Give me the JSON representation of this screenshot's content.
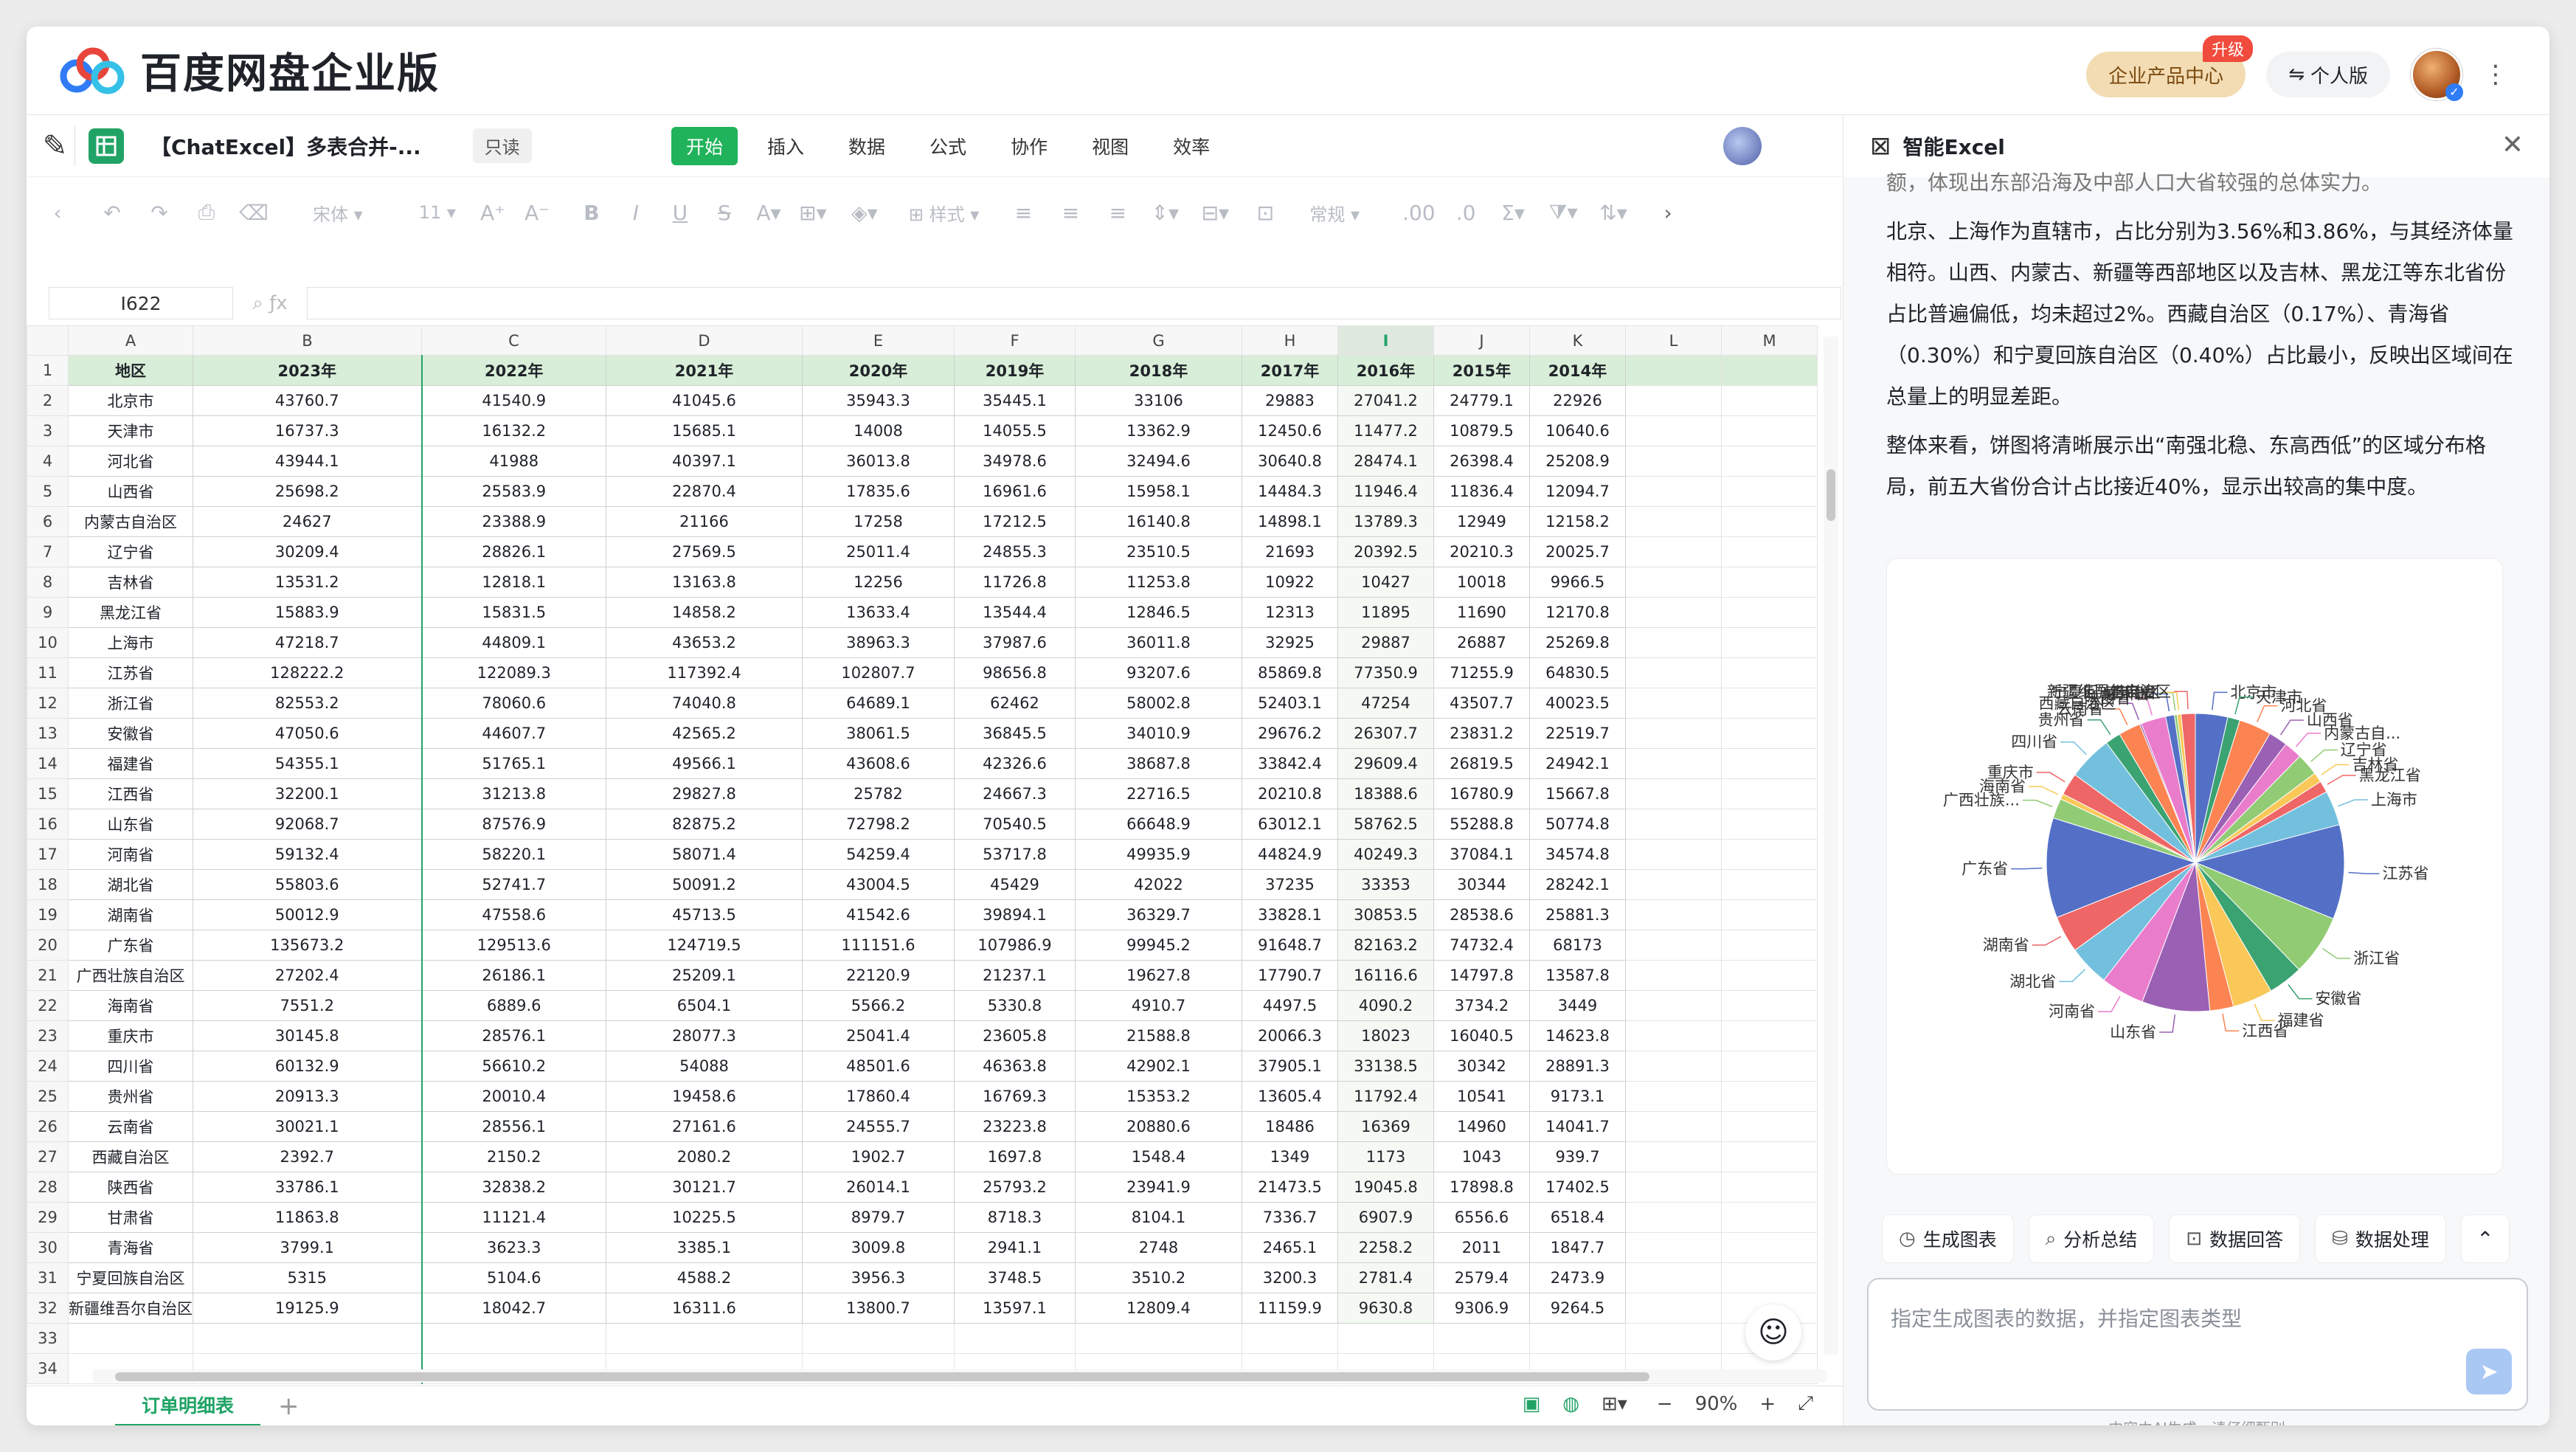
{
  "app": {
    "brand": "百度网盘企业版",
    "enterprise_center": "企业产品中心",
    "upgrade_badge": "升级",
    "personal": "个人版"
  },
  "doc": {
    "title": "【ChatExcel】多表合并-...",
    "readonly": "只读",
    "menu": [
      "开始",
      "插入",
      "数据",
      "公式",
      "协作",
      "视图",
      "效率"
    ],
    "toolbar": {
      "font": "宋体",
      "size": "11",
      "style": "样式",
      "format": "常规"
    },
    "cell_ref": "I622",
    "sheet_tab": "订单明细表",
    "zoom": "90%"
  },
  "grid": {
    "col_letters": [
      "A",
      "B",
      "C",
      "D",
      "E",
      "F",
      "G",
      "H",
      "I",
      "J",
      "K",
      "L",
      "M"
    ],
    "headers": [
      "地区",
      "2023年",
      "2022年",
      "2021年",
      "2020年",
      "2019年",
      "2018年",
      "2017年",
      "2016年",
      "2015年",
      "2014年"
    ],
    "rows": [
      [
        "北京市",
        "43760.7",
        "41540.9",
        "41045.6",
        "35943.3",
        "35445.1",
        "33106",
        "29883",
        "27041.2",
        "24779.1",
        "22926"
      ],
      [
        "天津市",
        "16737.3",
        "16132.2",
        "15685.1",
        "14008",
        "14055.5",
        "13362.9",
        "12450.6",
        "11477.2",
        "10879.5",
        "10640.6"
      ],
      [
        "河北省",
        "43944.1",
        "41988",
        "40397.1",
        "36013.8",
        "34978.6",
        "32494.6",
        "30640.8",
        "28474.1",
        "26398.4",
        "25208.9"
      ],
      [
        "山西省",
        "25698.2",
        "25583.9",
        "22870.4",
        "17835.6",
        "16961.6",
        "15958.1",
        "14484.3",
        "11946.4",
        "11836.4",
        "12094.7"
      ],
      [
        "内蒙古自治区",
        "24627",
        "23388.9",
        "21166",
        "17258",
        "17212.5",
        "16140.8",
        "14898.1",
        "13789.3",
        "12949",
        "12158.2"
      ],
      [
        "辽宁省",
        "30209.4",
        "28826.1",
        "27569.5",
        "25011.4",
        "24855.3",
        "23510.5",
        "21693",
        "20392.5",
        "20210.3",
        "20025.7"
      ],
      [
        "吉林省",
        "13531.2",
        "12818.1",
        "13163.8",
        "12256",
        "11726.8",
        "11253.8",
        "10922",
        "10427",
        "10018",
        "9966.5"
      ],
      [
        "黑龙江省",
        "15883.9",
        "15831.5",
        "14858.2",
        "13633.4",
        "13544.4",
        "12846.5",
        "12313",
        "11895",
        "11690",
        "12170.8"
      ],
      [
        "上海市",
        "47218.7",
        "44809.1",
        "43653.2",
        "38963.3",
        "37987.6",
        "36011.8",
        "32925",
        "29887",
        "26887",
        "25269.8"
      ],
      [
        "江苏省",
        "128222.2",
        "122089.3",
        "117392.4",
        "102807.7",
        "98656.8",
        "93207.6",
        "85869.8",
        "77350.9",
        "71255.9",
        "64830.5"
      ],
      [
        "浙江省",
        "82553.2",
        "78060.6",
        "74040.8",
        "64689.1",
        "62462",
        "58002.8",
        "52403.1",
        "47254",
        "43507.7",
        "40023.5"
      ],
      [
        "安徽省",
        "47050.6",
        "44607.7",
        "42565.2",
        "38061.5",
        "36845.5",
        "34010.9",
        "29676.2",
        "26307.7",
        "23831.2",
        "22519.7"
      ],
      [
        "福建省",
        "54355.1",
        "51765.1",
        "49566.1",
        "43608.6",
        "42326.6",
        "38687.8",
        "33842.4",
        "29609.4",
        "26819.5",
        "24942.1"
      ],
      [
        "江西省",
        "32200.1",
        "31213.8",
        "29827.8",
        "25782",
        "24667.3",
        "22716.5",
        "20210.8",
        "18388.6",
        "16780.9",
        "15667.8"
      ],
      [
        "山东省",
        "92068.7",
        "87576.9",
        "82875.2",
        "72798.2",
        "70540.5",
        "66648.9",
        "63012.1",
        "58762.5",
        "55288.8",
        "50774.8"
      ],
      [
        "河南省",
        "59132.4",
        "58220.1",
        "58071.4",
        "54259.4",
        "53717.8",
        "49935.9",
        "44824.9",
        "40249.3",
        "37084.1",
        "34574.8"
      ],
      [
        "湖北省",
        "55803.6",
        "52741.7",
        "50091.2",
        "43004.5",
        "45429",
        "42022",
        "37235",
        "33353",
        "30344",
        "28242.1"
      ],
      [
        "湖南省",
        "50012.9",
        "47558.6",
        "45713.5",
        "41542.6",
        "39894.1",
        "36329.7",
        "33828.1",
        "30853.5",
        "28538.6",
        "25881.3"
      ],
      [
        "广东省",
        "135673.2",
        "129513.6",
        "124719.5",
        "111151.6",
        "107986.9",
        "99945.2",
        "91648.7",
        "82163.2",
        "74732.4",
        "68173"
      ],
      [
        "广西壮族自治区",
        "27202.4",
        "26186.1",
        "25209.1",
        "22120.9",
        "21237.1",
        "19627.8",
        "17790.7",
        "16116.6",
        "14797.8",
        "13587.8"
      ],
      [
        "海南省",
        "7551.2",
        "6889.6",
        "6504.1",
        "5566.2",
        "5330.8",
        "4910.7",
        "4497.5",
        "4090.2",
        "3734.2",
        "3449"
      ],
      [
        "重庆市",
        "30145.8",
        "28576.1",
        "28077.3",
        "25041.4",
        "23605.8",
        "21588.8",
        "20066.3",
        "18023",
        "16040.5",
        "14623.8"
      ],
      [
        "四川省",
        "60132.9",
        "56610.2",
        "54088",
        "48501.6",
        "46363.8",
        "42902.1",
        "37905.1",
        "33138.5",
        "30342",
        "28891.3"
      ],
      [
        "贵州省",
        "20913.3",
        "20010.4",
        "19458.6",
        "17860.4",
        "16769.3",
        "15353.2",
        "13605.4",
        "11792.4",
        "10541",
        "9173.1"
      ],
      [
        "云南省",
        "30021.1",
        "28556.1",
        "27161.6",
        "24555.7",
        "23223.8",
        "20880.6",
        "18486",
        "16369",
        "14960",
        "14041.7"
      ],
      [
        "西藏自治区",
        "2392.7",
        "2150.2",
        "2080.2",
        "1902.7",
        "1697.8",
        "1548.4",
        "1349",
        "1173",
        "1043",
        "939.7"
      ],
      [
        "陕西省",
        "33786.1",
        "32838.2",
        "30121.7",
        "26014.1",
        "25793.2",
        "23941.9",
        "21473.5",
        "19045.8",
        "17898.8",
        "17402.5"
      ],
      [
        "甘肃省",
        "11863.8",
        "11121.4",
        "10225.5",
        "8979.7",
        "8718.3",
        "8104.1",
        "7336.7",
        "6907.9",
        "6556.6",
        "6518.4"
      ],
      [
        "青海省",
        "3799.1",
        "3623.3",
        "3385.1",
        "3009.8",
        "2941.1",
        "2748",
        "2465.1",
        "2258.2",
        "2011",
        "1847.7"
      ],
      [
        "宁夏回族自治区",
        "5315",
        "5104.6",
        "4588.2",
        "3956.3",
        "3748.5",
        "3510.2",
        "3200.3",
        "2781.4",
        "2579.4",
        "2473.9"
      ],
      [
        "新疆维吾尔自治区",
        "19125.9",
        "18042.7",
        "16311.6",
        "13800.7",
        "13597.1",
        "12809.4",
        "11159.9",
        "9630.8",
        "9306.9",
        "9264.5"
      ]
    ]
  },
  "ai": {
    "title": "智能Excel",
    "para0": "额，体现出东部沿海及中部人口大省较强的总体实力。",
    "para1": "北京、上海作为直辖市，占比分别为3.56%和3.86%，与其经济体量相符。山西、内蒙古、新疆等西部地区以及吉林、黑龙江等东北省份占比普遍偏低，均未超过2%。西藏自治区（0.17%）、青海省（0.30%）和宁夏回族自治区（0.40%）占比最小，反映出区域间在总量上的明显差距。",
    "para2": "整体来看，饼图将清晰展示出“南强北稳、东高西低”的区域分布格局，前五大省份合计占比接近40%，显示出较高的集中度。",
    "actions": [
      "生成图表",
      "分析总结",
      "数据回答",
      "数据处理"
    ],
    "input_placeholder": "指定生成图表的数据，并指定图表类型",
    "disclaimer": "内容由AI生成，请仔细甄别"
  },
  "chart_data": {
    "type": "pie",
    "categories": [
      "北京市",
      "天津市",
      "河北省",
      "山西省",
      "内蒙古自...",
      "辽宁省",
      "吉林省",
      "黑龙江省",
      "上海市",
      "江苏省",
      "浙江省",
      "安徽省",
      "福建省",
      "江西省",
      "山东省",
      "河南省",
      "湖北省",
      "湖南省",
      "广东省",
      "广西壮族...",
      "海南省",
      "重庆市",
      "四川省",
      "贵州省",
      "云南省",
      "西藏自治区",
      "陕西省",
      "甘肃省",
      "青海省",
      "宁夏回族自治区",
      "新疆维吾尔自治区"
    ],
    "values": [
      43760.7,
      16737.3,
      43944.1,
      25698.2,
      24627,
      30209.4,
      13531.2,
      15883.9,
      47218.7,
      128222.2,
      82553.2,
      47050.6,
      54355.1,
      32200.1,
      92068.7,
      59132.4,
      55803.6,
      50012.9,
      135673.2,
      27202.4,
      7551.2,
      30145.8,
      60132.9,
      20913.3,
      30021.1,
      2392.7,
      33786.1,
      11863.8,
      3799.1,
      5315,
      19125.9
    ],
    "colors": [
      "#5470c6",
      "#3ba272",
      "#fc8452",
      "#9a60b4",
      "#ea7ccc",
      "#91cc75",
      "#fac858",
      "#ee6666",
      "#73c0de",
      "#5470c6",
      "#91cc75",
      "#3ba272",
      "#fac858",
      "#fc8452",
      "#9a60b4",
      "#ea7ccc",
      "#73c0de",
      "#ee6666",
      "#5470c6",
      "#91cc75",
      "#fac858",
      "#ee6666",
      "#73c0de",
      "#3ba272",
      "#fc8452",
      "#9a60b4",
      "#ea7ccc",
      "#5470c6",
      "#91cc75",
      "#fac858",
      "#ee6666"
    ]
  }
}
